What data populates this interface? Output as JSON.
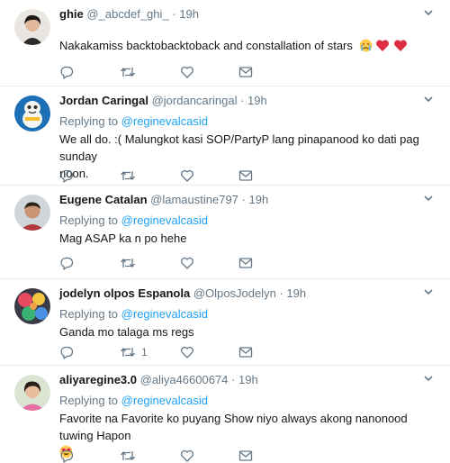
{
  "tweets": [
    {
      "name": "ghie",
      "handle": "@_abcdef_ghi_",
      "dot": "·",
      "time": "19h",
      "replying": null,
      "text": "Nakakamiss backtobacktoback and constallation of stars",
      "emoji": [
        "crying-face",
        "red-heart",
        "red-heart"
      ],
      "retweets": "",
      "avatar": "woman-portrait"
    },
    {
      "name": "Jordan Caringal",
      "handle": "@jordancaringal",
      "dot": "·",
      "time": "19h",
      "replying": {
        "prefix": "Replying to",
        "mention": "@reginevalcasid"
      },
      "text_lines": [
        "We all do. :( Malungkot kasi SOP/PartyP lang pinapanood ko dati pag sunday",
        "noon."
      ],
      "retweets": "",
      "avatar": "cartoon-character"
    },
    {
      "name": "Eugene Catalan",
      "handle": "@lamaustine797",
      "dot": "·",
      "time": "19h",
      "replying": {
        "prefix": "Replying to",
        "mention": "@reginevalcasid"
      },
      "text": "Mag ASAP ka n po hehe",
      "retweets": "",
      "avatar": "man-portrait"
    },
    {
      "name": "jodelyn olpos Espanola",
      "handle": "@OlposJodelyn",
      "dot": "·",
      "time": "19h",
      "replying": {
        "prefix": "Replying to",
        "mention": "@reginevalcasid"
      },
      "text": "Ganda mo talaga ms regs",
      "retweets": "1",
      "avatar": "colorful-photo"
    },
    {
      "name": "aliyaregine3.0",
      "handle": "@aliya46600674",
      "dot": "·",
      "time": "19h",
      "replying": {
        "prefix": "Replying to",
        "mention": "@reginevalcasid"
      },
      "text": "Favorite na Favorite ko puyang Show niyo always akong nanonood tuwing Hapon",
      "emoji": [
        "heart-eyes"
      ],
      "retweets": "",
      "avatar": "woman-in-pink"
    }
  ],
  "colors": {
    "accent": "#1da1f2",
    "muted": "#657786",
    "text": "#14171a",
    "heart": "#e0245e",
    "border": "#e6ecf0"
  }
}
